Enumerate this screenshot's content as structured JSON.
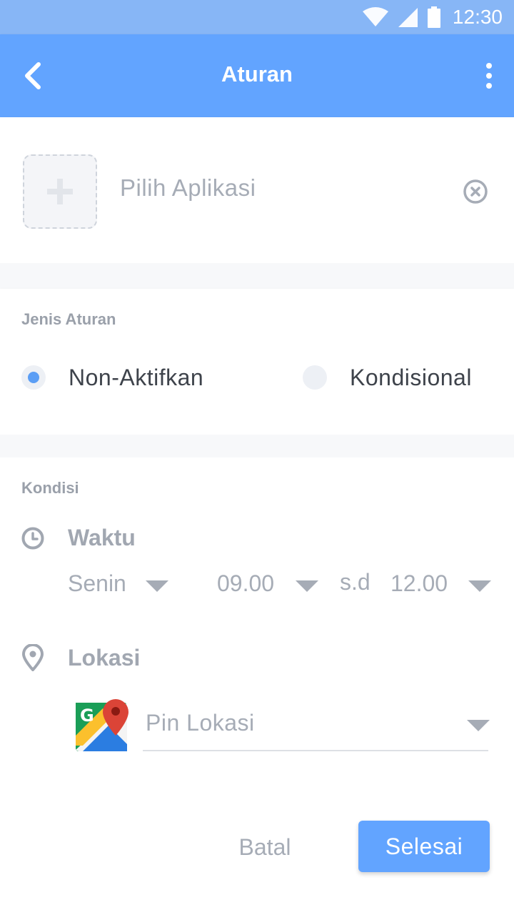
{
  "status_bar": {
    "time": "12:30",
    "icons": [
      "wifi-icon",
      "signal-icon",
      "battery-icon"
    ]
  },
  "header": {
    "title": "Aturan",
    "back_icon": "chevron-left-icon",
    "menu_icon": "more-vertical-icon"
  },
  "app_select": {
    "placeholder": "Pilih Aplikasi",
    "add_icon": "plus-icon",
    "clear_icon": "close-circle-icon"
  },
  "rule_type": {
    "label": "Jenis Aturan",
    "options": [
      {
        "label": "Non-Aktifkan",
        "selected": true
      },
      {
        "label": "Kondisional",
        "selected": false
      }
    ]
  },
  "condition": {
    "label": "Kondisi",
    "time": {
      "title": "Waktu",
      "icon": "clock-icon",
      "day": "Senin",
      "start": "09.00",
      "separator": "s.d",
      "end": "12.00"
    },
    "location": {
      "title": "Lokasi",
      "icon": "location-pin-icon",
      "maps_icon": "google-maps-icon",
      "placeholder": "Pin Lokasi"
    }
  },
  "actions": {
    "cancel": "Batal",
    "done": "Selesai"
  },
  "colors": {
    "primary": "#62a4ff",
    "status_bar": "#87b6f6",
    "muted_text": "#a6acb6",
    "label_text": "#9aa0aa",
    "body_text": "#3e434b",
    "radio_selected": "#5b9ef5"
  }
}
